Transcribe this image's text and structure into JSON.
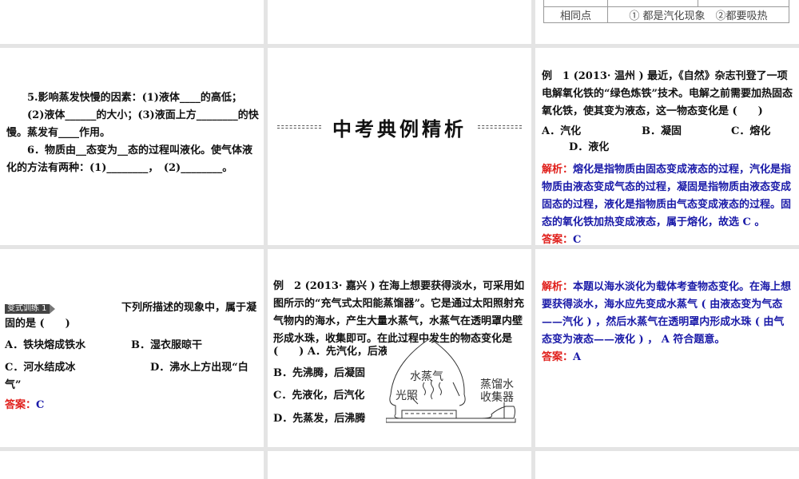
{
  "slide_top_right": {
    "table_row_label": "相同点",
    "table_row_value": "① 都是汽化现象　②都要吸热"
  },
  "slide_fill": {
    "p1": "5.影响蒸发快慢的因素：(1)液体____的高低；",
    "p2": "(2)液体______的大小；(3)液面上方________的快慢。蒸发有____作用。",
    "p3": "6．物质由__态变为__态的过程叫液化。使气体液化的方法有两种：(1)________，　(2)________。"
  },
  "slide_section": {
    "title": "中考典例精析"
  },
  "slide_ex1": {
    "question": "例　1 (2013· 温州 ) 最近，《自然》杂志刊登了一项电解氧化铁的“绿色炼铁”技术。电解之前需要加热固态氧化铁，使其变为液态，这一物态变化是 (　　)",
    "A": "A．汽化",
    "B": "B．凝固",
    "C": "C．熔化",
    "D": "D．液化",
    "analysis_label": "解析：",
    "analysis": "熔化是指物质由固态变成液态的过程，汽化是指物质由液态变成气态的过程，凝固是指物质由液态变成固态的过程，液化是指物质由气态变成液态的过程。固态的氧化铁加热变成液态，属于熔化，故选 C 。",
    "answer_label": "答案：",
    "answer": "C"
  },
  "slide_practice": {
    "badge": "变式训练 1",
    "question_tail": "下列所描述的现象中，属于凝",
    "question_line2": "固的是 (　　)",
    "A": "A．铁块熔成铁水",
    "B": "B．湿衣服晾干",
    "C": "C．河水结成冰",
    "D": "D．沸水上方出现“白气”",
    "answer_label": "答案：",
    "answer": "C"
  },
  "slide_ex2": {
    "question": "例　2 (2013· 嘉兴 ) 在海上想要获得淡水，可采用如图所示的“充气式太阳能蒸馏器”。它是通过太阳照射充气物内的海水，产生大量水蒸气，水蒸气在透明罩内壁形成水珠，收集即可。在此过程中发生的物态变化是",
    "A": "(　　) A．先汽化，后液化",
    "B": "B．先沸腾，后凝固",
    "C": "C．先液化，后汽化",
    "D": "D．先蒸发，后沸腾",
    "diagram": {
      "vapor": "水蒸气",
      "light": "光照",
      "collector1": "蒸馏水",
      "collector2": "收集器"
    }
  },
  "slide_ex2_answer": {
    "analysis_label": "解析：",
    "analysis": "本题以海水淡化为载体考查物态变化。在海上想要获得淡水，海水应先变成水蒸气 ( 由液态变为气态——汽化 ) ，然后水蒸气在透明罩内形成水珠 ( 由气态变为液态——液化 ) ， A 符合题意。",
    "answer_label": "答案：",
    "answer": "A"
  }
}
